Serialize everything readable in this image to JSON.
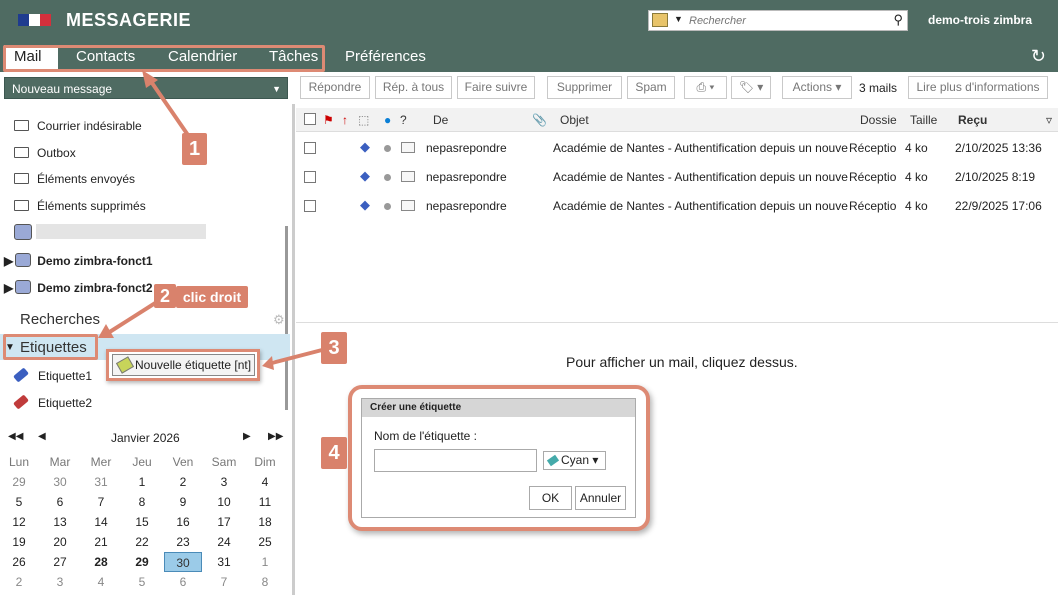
{
  "app": {
    "title": "MESSAGERIE",
    "user": "demo-trois zimbra"
  },
  "search": {
    "placeholder": "Rechercher"
  },
  "tabs": [
    "Mail",
    "Contacts",
    "Calendrier",
    "Tâches",
    "Préférences"
  ],
  "new_message": "Nouveau message",
  "toolbar": [
    "Répondre",
    "Rép. à tous",
    "Faire suivre",
    "Supprimer",
    "Spam",
    "Actions",
    "3 mails",
    "Lire plus d'informations"
  ],
  "folders": [
    "Courrier indésirable",
    "Outbox",
    "Éléments envoyés",
    "Éléments supprimés"
  ],
  "accounts": [
    "Demo zimbra-fonct1",
    "Demo zimbra-fonct2"
  ],
  "sections": {
    "searches": "Recherches",
    "tags": "Etiquettes"
  },
  "tags": [
    {
      "label": "Etiquette1",
      "color": "#3b5fc0"
    },
    {
      "label": "Etiquette2",
      "color": "#c03b3b"
    }
  ],
  "calendar": {
    "month": "Janvier 2026",
    "weekdays": [
      "Lun",
      "Mar",
      "Mer",
      "Jeu",
      "Ven",
      "Sam",
      "Dim"
    ],
    "weeks": [
      [
        "29",
        "30",
        "31",
        "1",
        "2",
        "3",
        "4"
      ],
      [
        "5",
        "6",
        "7",
        "8",
        "9",
        "10",
        "11"
      ],
      [
        "12",
        "13",
        "14",
        "15",
        "16",
        "17",
        "18"
      ],
      [
        "19",
        "20",
        "21",
        "22",
        "23",
        "24",
        "25"
      ],
      [
        "26",
        "27",
        "28",
        "29",
        "30",
        "31",
        "1"
      ],
      [
        "2",
        "3",
        "4",
        "5",
        "6",
        "7",
        "8"
      ]
    ],
    "today": "30"
  },
  "list_columns": [
    "De",
    "Objet",
    "Dossie",
    "Taille",
    "Reçu"
  ],
  "messages": [
    {
      "from": "nepasrepondre",
      "subject": "Académie de Nantes - Authentification depuis un nouve",
      "folder": "Réceptio",
      "size": "4 ko",
      "received": "2/10/2025 13:36"
    },
    {
      "from": "nepasrepondre",
      "subject": "Académie de Nantes - Authentification depuis un nouve",
      "folder": "Réceptio",
      "size": "4 ko",
      "received": "2/10/2025 8:19"
    },
    {
      "from": "nepasrepondre",
      "subject": "Académie de Nantes - Authentification depuis un nouve",
      "folder": "Réceptio",
      "size": "4 ko",
      "received": "22/9/2025 17:06"
    }
  ],
  "reading_pane": "Pour afficher un mail, cliquez dessus.",
  "context_menu": "Nouvelle étiquette [nt]",
  "dialog": {
    "title": "Créer une étiquette",
    "label": "Nom de l'étiquette :",
    "color": "Cyan",
    "ok": "OK",
    "cancel": "Annuler"
  },
  "annotations": {
    "a1": "1",
    "a2": "2",
    "a2_text": "clic droit",
    "a3": "3",
    "a4": "4"
  },
  "colors": {
    "header": "#4f6b62",
    "annotation": "#d9826c"
  }
}
